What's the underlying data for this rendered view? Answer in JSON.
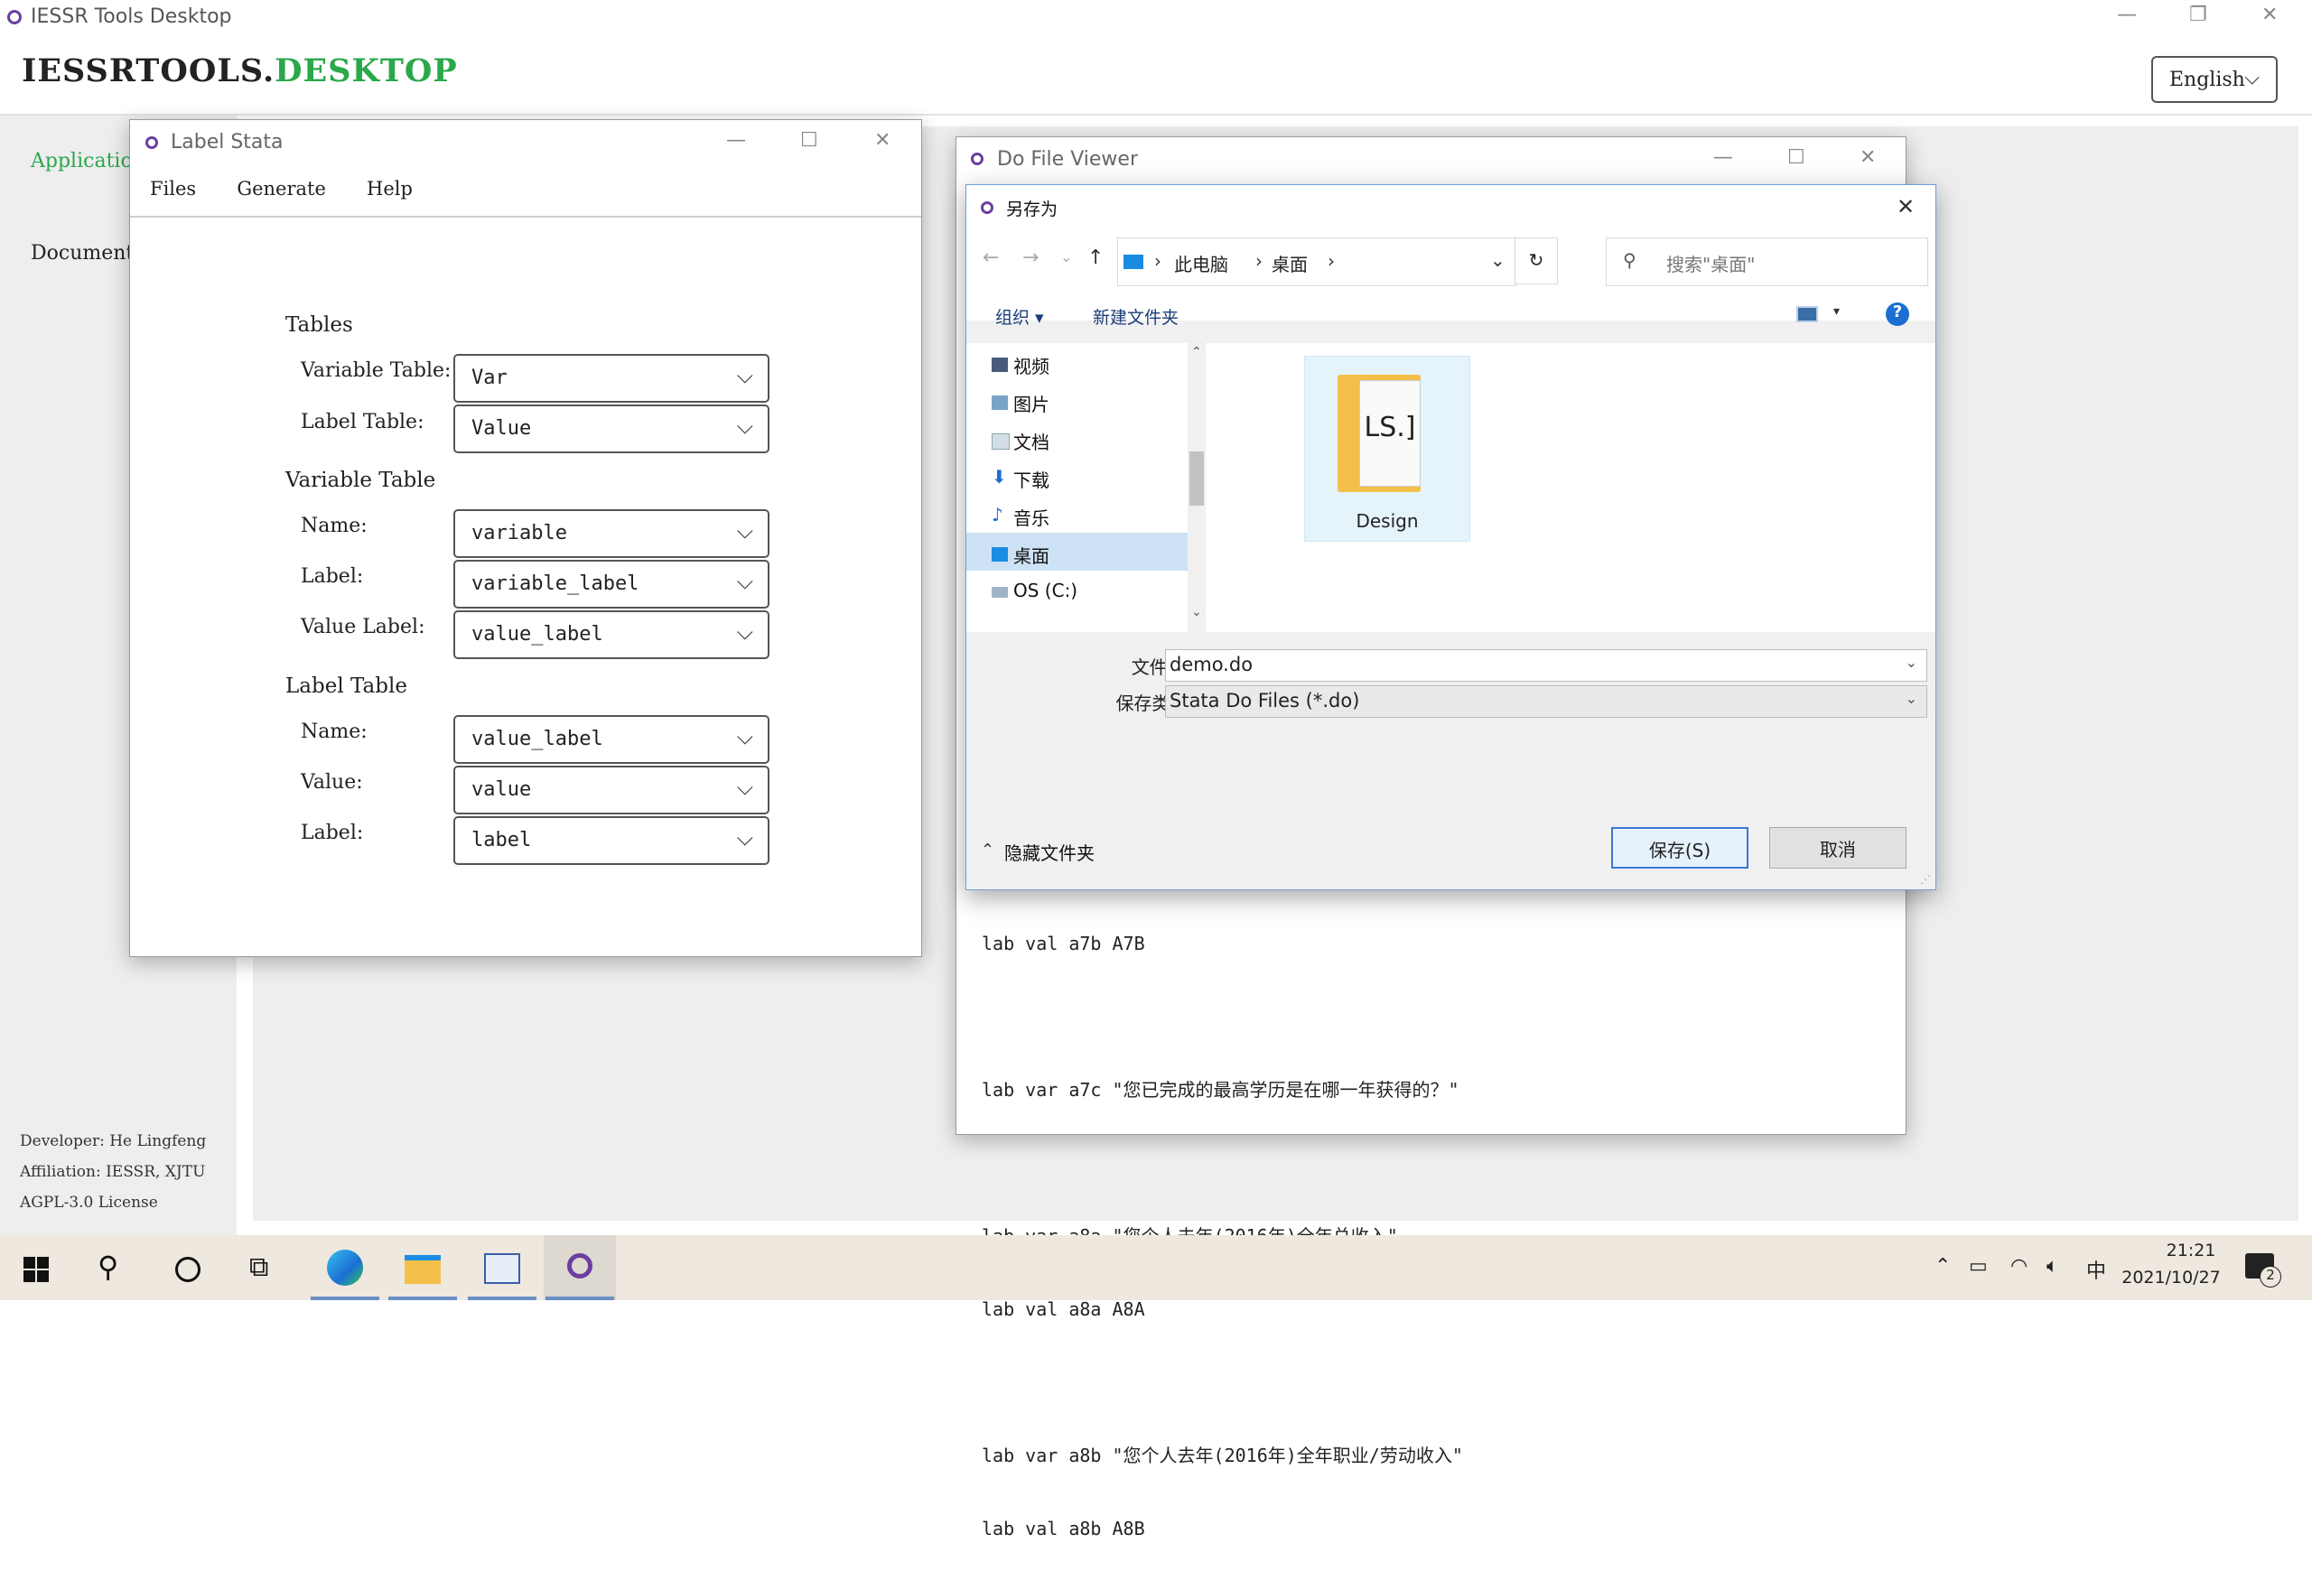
{
  "app": {
    "title": "IESSR Tools Desktop",
    "brand_main": "IESSRTOOLS.",
    "brand_accent": "DESKTOP",
    "language": "English",
    "window_controls": {
      "minimize": "—",
      "restore": "❐",
      "close": "✕"
    }
  },
  "sidebar": {
    "applications": "Applications",
    "documentation": "Documentation",
    "developer": "Developer: He Lingfeng",
    "affiliation": "Affiliation: IESSR, XJTU",
    "license": "AGPL-3.0 License"
  },
  "label_stata": {
    "title": "Label Stata",
    "menu": [
      "Files",
      "Generate",
      "Help"
    ],
    "tables": {
      "heading": "Tables",
      "variable_table_label": "Variable Table:",
      "variable_table_value": "Var",
      "label_table_label": "Label Table:",
      "label_table_value": "Value"
    },
    "variable_table": {
      "heading": "Variable Table",
      "name_label": "Name:",
      "name_value": "variable",
      "label_label": "Label:",
      "label_value": "variable_label",
      "value_label_label": "Value Label:",
      "value_label_value": "value_label"
    },
    "label_table": {
      "heading": "Label Table",
      "name_label": "Name:",
      "name_value": "value_label",
      "value_label": "Value:",
      "value_value": "value",
      "label_label": "Label:",
      "label_value": "label"
    }
  },
  "do_viewer": {
    "title": "Do File Viewer",
    "lines": [
      "lab val a7b A7B",
      "",
      "lab var a7c \"您已完成的最高学历是在哪一年获得的？\"",
      "",
      "lab var a8a \"您个人去年(2016年)全年总收入\"",
      "lab val a8a A8A",
      "",
      "lab var a8b \"您个人去年(2016年)全年职业/劳动收入\"",
      "lab val a8b A8B"
    ]
  },
  "save_dialog": {
    "title": "另存为",
    "path": [
      "此电脑",
      "桌面"
    ],
    "search_placeholder": "搜索\"桌面\"",
    "organize": "组织 ▾",
    "new_folder": "新建文件夹",
    "help": "?",
    "tree": [
      "视频",
      "图片",
      "文档",
      "下载",
      "音乐",
      "桌面",
      "OS (C:)"
    ],
    "selected_tree_item": "桌面",
    "files": [
      {
        "name": "Design",
        "thumb_text": "LS.]"
      }
    ],
    "filename_label": "文件名(N):",
    "filename_value": "demo.do",
    "filetype_label": "保存类型(T):",
    "filetype_value": "Stata Do Files (*.do)",
    "hide_folders": "隐藏文件夹",
    "save_button": "保存(S)",
    "cancel_button": "取消"
  },
  "taskbar": {
    "time": "21:21",
    "date": "2021/10/27",
    "ime": "中",
    "notifications": "2"
  },
  "colors": {
    "accent_green": "#2aa84a",
    "app_purple": "#6a3fa0",
    "dialog_blue": "#3b78d8"
  }
}
